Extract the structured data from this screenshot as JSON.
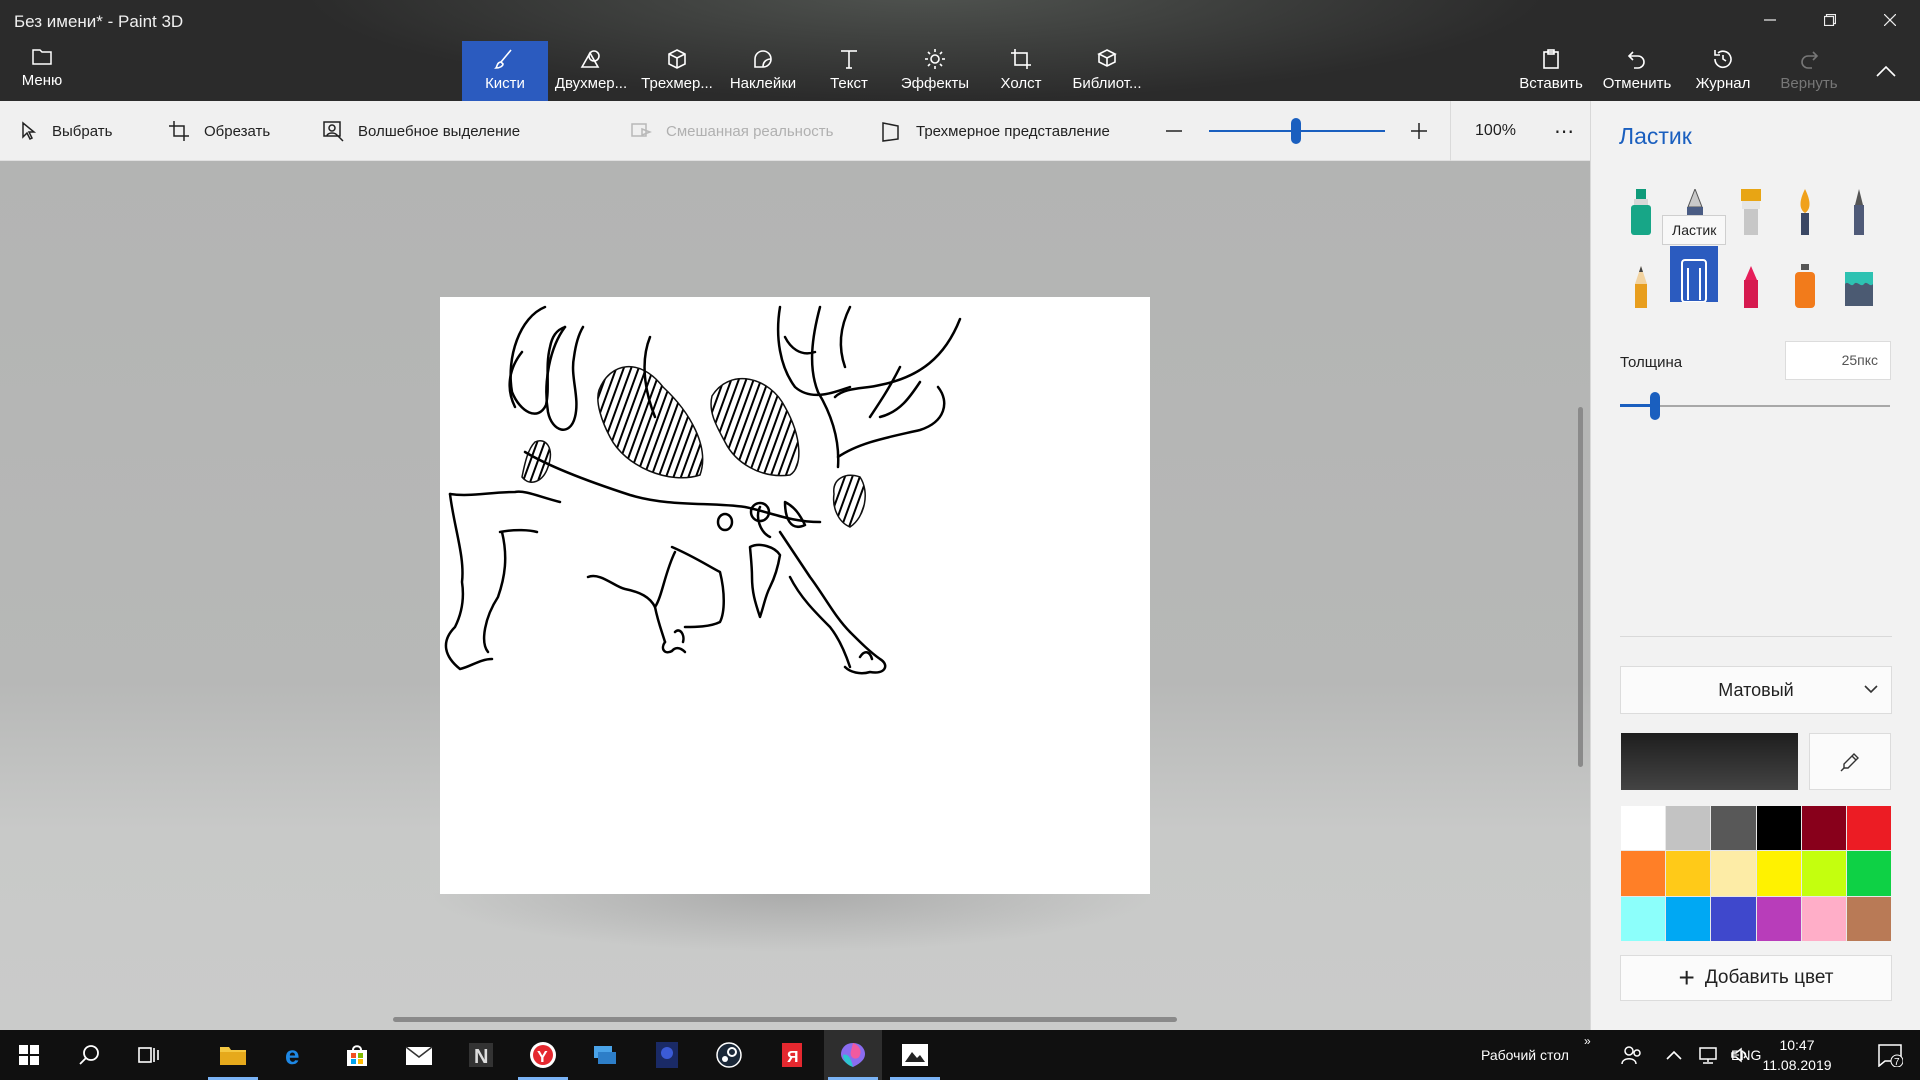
{
  "window": {
    "title": "Без имени* - Paint 3D"
  },
  "menu": {
    "label": "Меню"
  },
  "top_tools": [
    {
      "id": "brushes",
      "label": "Кисти",
      "icon": "brush-icon",
      "active": true
    },
    {
      "id": "2d",
      "label": "Двухмер...",
      "icon": "shapes-2d-icon",
      "active": false
    },
    {
      "id": "3d",
      "label": "Трехмер...",
      "icon": "cube-icon",
      "active": false
    },
    {
      "id": "stickers",
      "label": "Наклейки",
      "icon": "sticker-icon",
      "active": false
    },
    {
      "id": "text",
      "label": "Текст",
      "icon": "text-icon",
      "active": false
    },
    {
      "id": "effects",
      "label": "Эффекты",
      "icon": "effects-icon",
      "active": false
    },
    {
      "id": "canvas",
      "label": "Холст",
      "icon": "canvas-icon",
      "active": false
    },
    {
      "id": "library",
      "label": "Библиот...",
      "icon": "library-icon",
      "active": false
    }
  ],
  "actions": {
    "paste": "Вставить",
    "undo": "Отменить",
    "history": "Журнал",
    "redo": "Вернуть"
  },
  "subtoolbar": {
    "select": "Выбрать",
    "crop": "Обрезать",
    "magic_select": "Волшебное выделение",
    "mixed_reality": "Смешанная реальность",
    "view_3d": "Трехмерное представление",
    "zoom": "100%",
    "zoom_level": 0.57
  },
  "panel": {
    "title": "Ластик",
    "tooltip": "Ластик",
    "brushes": [
      {
        "name": "marker-brush-icon",
        "selected": false
      },
      {
        "name": "calligraphy-pen-brush-icon",
        "selected": false
      },
      {
        "name": "oil-brush-icon",
        "selected": false
      },
      {
        "name": "watercolor-brush-icon",
        "selected": false
      },
      {
        "name": "pixel-pen-brush-icon",
        "selected": false
      },
      {
        "name": "pencil-brush-icon",
        "selected": false
      },
      {
        "name": "eraser-brush-icon",
        "selected": true
      },
      {
        "name": "crayon-brush-icon",
        "selected": false
      },
      {
        "name": "spray-can-brush-icon",
        "selected": false
      },
      {
        "name": "fill-bucket-icon",
        "selected": false
      }
    ],
    "thickness_label": "Толщина",
    "thickness_value": "25пкс",
    "thickness_level": 0.13,
    "finish": "Матовый",
    "current_color": "#1e1e1e",
    "palette": [
      "#ffffff",
      "#c3c3c3",
      "#585858",
      "#000000",
      "#88001b",
      "#ec1c24",
      "#ff7f27",
      "#ffca18",
      "#fdeca6",
      "#fff200",
      "#c4ff0e",
      "#0ed145",
      "#8cfffb",
      "#00a8f3",
      "#3f48cc",
      "#b83dba",
      "#ffaec8",
      "#b97a56"
    ],
    "add_color": "Добавить цвет"
  },
  "taskbar": {
    "apps": [
      "start-icon",
      "search-icon",
      "task-view-icon",
      "file-explorer-icon",
      "edge-icon",
      "store-icon",
      "mail-icon",
      "notion-icon",
      "yandex-browser-icon",
      "network-app-icon",
      "game-app-icon",
      "steam-icon",
      "yandex-icon",
      "paint-3d-icon",
      "photos-icon"
    ],
    "desktop_label": "Рабочий стол",
    "lang": "ENG",
    "time": "10:47",
    "date": "11.08.2019",
    "notifications": "7"
  }
}
